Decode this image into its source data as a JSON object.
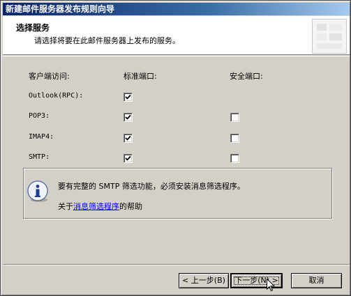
{
  "window": {
    "title": "新建邮件服务器发布规则向导"
  },
  "header": {
    "title": "选择服务",
    "subtitle": "请选择将要在此邮件服务器上发布的服务。"
  },
  "columns": {
    "client_access": "客户端访问:",
    "standard_port": "标准端口:",
    "secure_port": "安全端口:"
  },
  "services": [
    {
      "name": "Outlook(RPC):",
      "standard": true,
      "secure": null
    },
    {
      "name": "POP3:",
      "standard": true,
      "secure": false
    },
    {
      "name": "IMAP4:",
      "standard": true,
      "secure": false
    },
    {
      "name": "SMTP:",
      "standard": true,
      "secure": false
    }
  ],
  "info": {
    "icon": "info-icon",
    "message": "要有完整的 SMTP 筛选功能，必须安装消息筛选程序。",
    "link_prefix": "关于",
    "link_text": "消息筛选程序",
    "link_suffix": "的帮助"
  },
  "buttons": {
    "back": "< 上一步(B)",
    "next": "下一步(N) >",
    "cancel": "取消"
  }
}
